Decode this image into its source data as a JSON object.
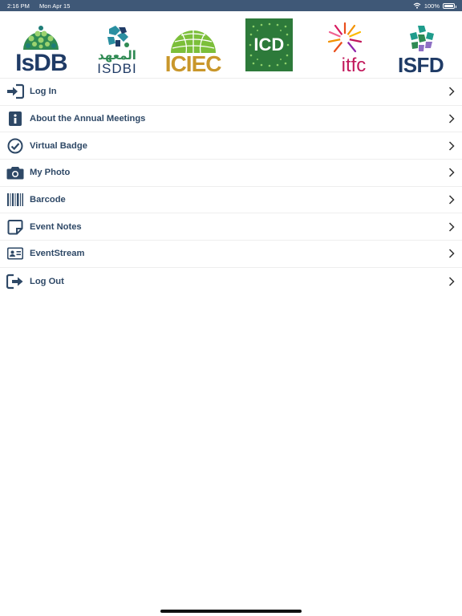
{
  "status_bar": {
    "time": "2:16 PM",
    "date": "Mon Apr 15",
    "battery": "100%",
    "battery_level": 1.0
  },
  "logos": [
    {
      "name": "isdb",
      "text": "IsDB",
      "color": "#1f3b66"
    },
    {
      "name": "isdbi",
      "text": "ISDBI",
      "subtext": "المعهد",
      "color": "#1f3b66"
    },
    {
      "name": "iciec",
      "text": "ICIEC",
      "color": "#c9972b"
    },
    {
      "name": "icd",
      "text": "ICD",
      "color": "#ffffff"
    },
    {
      "name": "itfc",
      "text": "itfc",
      "color": "#c2185b"
    },
    {
      "name": "isfd",
      "text": "ISFD",
      "color": "#1f3b66"
    }
  ],
  "menu": {
    "items": [
      {
        "label": "Log In",
        "icon": "login-icon"
      },
      {
        "label": "About the Annual Meetings",
        "icon": "info-icon"
      },
      {
        "label": "Virtual Badge",
        "icon": "check-circle-icon"
      },
      {
        "label": "My Photo",
        "icon": "camera-icon"
      },
      {
        "label": "Barcode",
        "icon": "barcode-icon"
      },
      {
        "label": "Event Notes",
        "icon": "note-icon"
      },
      {
        "label": "EventStream",
        "icon": "id-card-icon"
      },
      {
        "label": "Log Out",
        "icon": "logout-icon"
      }
    ]
  },
  "colors": {
    "status_bar": "#3f5877",
    "text": "#2e4866",
    "icon": "#2e4866",
    "green": "#3a8f3a",
    "teal": "#1f9c8c"
  }
}
